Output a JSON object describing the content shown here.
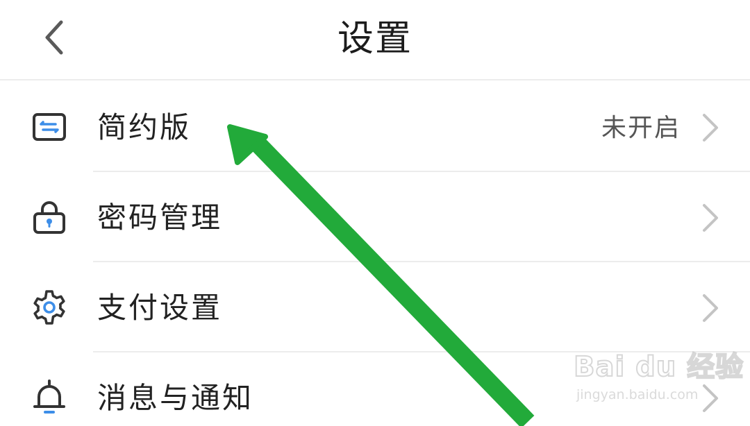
{
  "header": {
    "title": "设置",
    "back_icon": "chevron-left-icon"
  },
  "settings": [
    {
      "key": "simple-mode",
      "label": "简约版",
      "value": "未开启",
      "icon": "simple-mode-icon"
    },
    {
      "key": "password",
      "label": "密码管理",
      "value": "",
      "icon": "lock-icon"
    },
    {
      "key": "payment",
      "label": "支付设置",
      "value": "",
      "icon": "gear-icon"
    },
    {
      "key": "notifications",
      "label": "消息与通知",
      "value": "",
      "icon": "bell-icon"
    }
  ],
  "annotation": {
    "type": "arrow",
    "color": "#22aa3a",
    "target": "simple-mode"
  },
  "watermark": {
    "logo": "Bai du 经验",
    "url": "jingyan.baidu.com"
  },
  "colors": {
    "icon_accent": "#3d8ee8",
    "icon_stroke": "#333333",
    "chevron": "#c4c4c4"
  }
}
